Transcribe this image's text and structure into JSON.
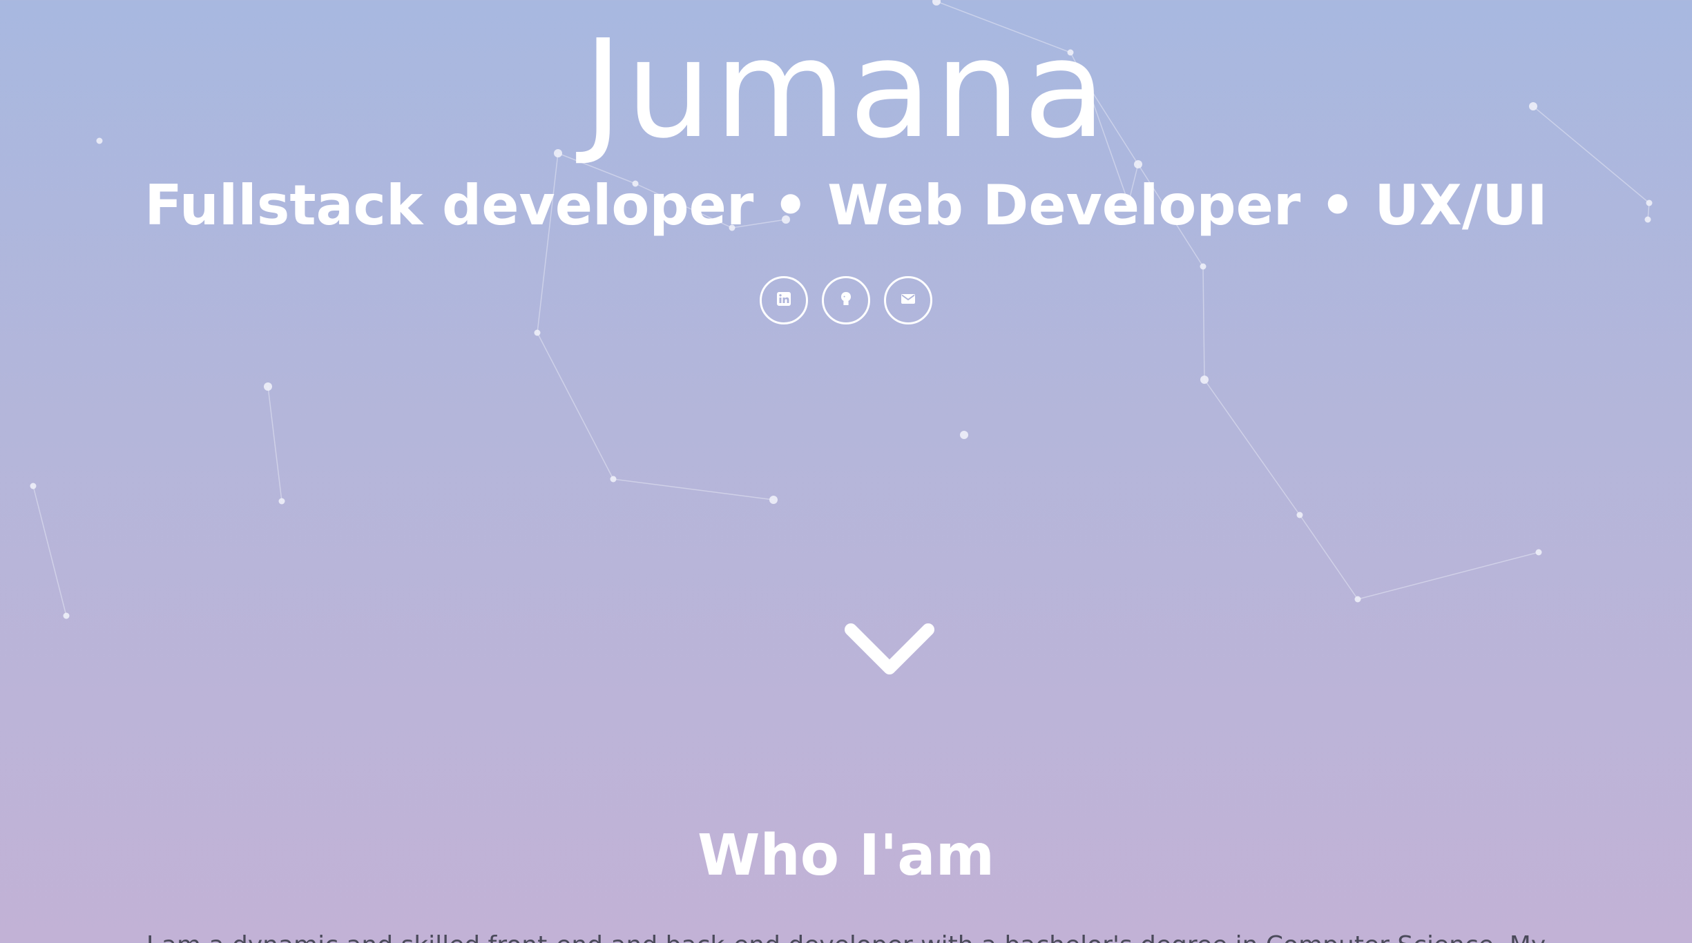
{
  "hero": {
    "name": "Jumana",
    "tagline": "Fullstack developer • Web Developer • UX/UI"
  },
  "social": [
    {
      "name": "linkedin",
      "icon": "linkedin-icon"
    },
    {
      "name": "github",
      "icon": "github-icon"
    },
    {
      "name": "email",
      "icon": "envelope-icon"
    }
  ],
  "scroll": {
    "icon": "chevron-down-icon"
  },
  "about": {
    "title": "Who I'am",
    "intro": "I am a dynamic and skilled front-end and back-end developer with a bachelor's degree in Computer Science. My"
  },
  "colors": {
    "background_top": "#a8b8e0",
    "background_bottom": "#c2b2d6",
    "text": "#ffffff",
    "network_line": "#e6e8f4"
  }
}
